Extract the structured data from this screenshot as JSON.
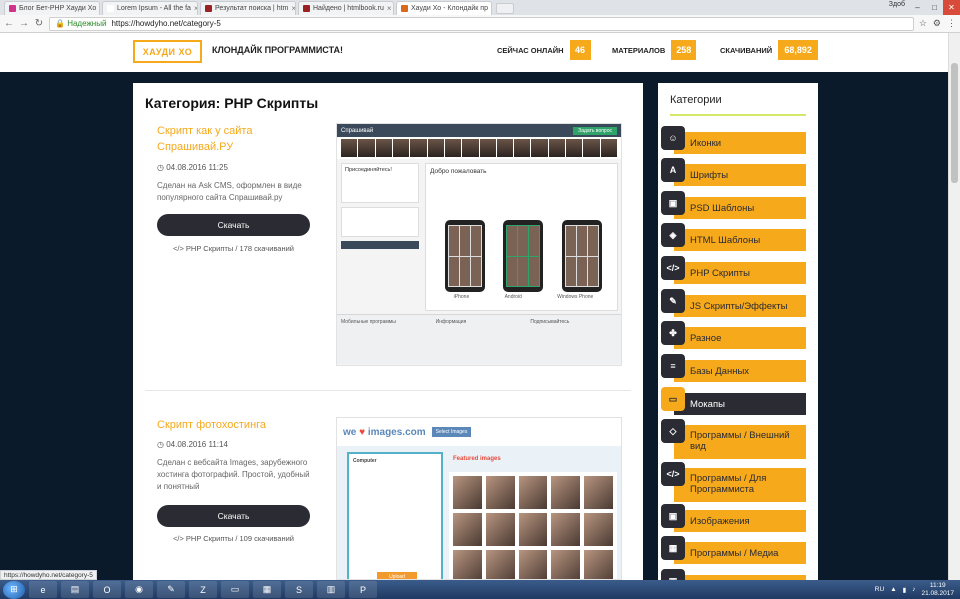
{
  "browser": {
    "tabs": [
      {
        "label": "Блог Бет-PHP Хауди Хо",
        "color": "#d0338a",
        "active": false
      },
      {
        "label": "Lorem Ipsum - All the fa",
        "color": "#ffffff",
        "active": false
      },
      {
        "label": "Результат поиска | htm",
        "color": "#9a2222",
        "active": false
      },
      {
        "label": "Найдено | htmlbook.ru",
        "color": "#9a2222",
        "active": false
      },
      {
        "label": "Хауди Хо - Клондайк пр",
        "color": "#d96a1b",
        "active": true
      }
    ],
    "user_label": "Здоб",
    "security_label": "Надежный",
    "url": "https://howdyho.net/category-5",
    "window_controls": [
      "–",
      "□",
      "✕"
    ],
    "tool_icons": [
      "☆",
      "⚙",
      "⋮"
    ]
  },
  "header": {
    "logo": "ХАУДИ ХО",
    "tagline": "КЛОНДАЙК ПРОГРАММИСТА!",
    "stats": [
      {
        "label": "СЕЙЧАС ОНЛАЙН",
        "value": "46"
      },
      {
        "label": "МАТЕРИАЛОВ",
        "value": "258"
      },
      {
        "label": "СКАЧИВАНИЙ",
        "value": "68,892"
      }
    ]
  },
  "content": {
    "category_title": "Категория: PHP Скрипты",
    "posts": [
      {
        "title": "Скрипт как у сайта Спрашивай.РУ",
        "date": "◷ 04.08.2016 11:25",
        "desc": "Сделан на Ask CMS, оформлен в виде популярного сайта Спрашивай.ру",
        "button": "Скачать",
        "meta": "</> PHP Скрипты / 178 скачиваний",
        "mock": {
          "brand": "Спрашивай",
          "pill": "Задать вопрос",
          "left_title": "Присоединяйтесь!",
          "welcome": "Добро пожаловать",
          "platforms": [
            "iPhone",
            "Android",
            "Windows Phone"
          ],
          "footer": [
            "Мобильные программы",
            "Информация",
            "Подписывайтесь"
          ]
        }
      },
      {
        "title": "Скрипт фотохостинга",
        "date": "◷ 04.08.2016 11:14",
        "desc": "Сделан с вебсайта Images, зарубежного хостинга фотографий. Простой, удобный и понятный",
        "button": "Скачать",
        "meta": "</> PHP Скрипты / 109 скачиваний",
        "mock": {
          "logo_a": "we ",
          "logo_heart": "♥",
          "logo_b": " images.com",
          "btn": "Select Images",
          "panel_title": "Computer",
          "upload": "Upload",
          "gallery_title": "Featured images"
        }
      }
    ]
  },
  "sidebar": {
    "title": "Категории",
    "items": [
      {
        "label": "Иконки",
        "icon": "☺",
        "icon_name": "smiley-icon"
      },
      {
        "label": "Шрифты",
        "icon": "A",
        "icon_name": "font-icon"
      },
      {
        "label": "PSD Шаблоны",
        "icon": "▣",
        "icon_name": "image-icon"
      },
      {
        "label": "HTML Шаблоны",
        "icon": "◈",
        "icon_name": "cube-icon"
      },
      {
        "label": "PHP Скрипты",
        "icon": "</>",
        "icon_name": "code-icon"
      },
      {
        "label": "JS Скрипты/Эффекты",
        "icon": "✎",
        "icon_name": "wand-icon"
      },
      {
        "label": "Разное",
        "icon": "✤",
        "icon_name": "cubes-icon"
      },
      {
        "label": "Базы Данных",
        "icon": "≡",
        "icon_name": "database-icon"
      },
      {
        "label": "Мокапы",
        "icon": "▭",
        "icon_name": "monitor-icon",
        "active": true
      },
      {
        "label": "Программы / Внешний вид",
        "icon": "◇",
        "icon_name": "diamond-icon",
        "tall": true
      },
      {
        "label": "Программы / Для Программиста",
        "icon": "</>",
        "icon_name": "code-icon",
        "tall": true
      },
      {
        "label": "Изображения",
        "icon": "▣",
        "icon_name": "image-icon"
      },
      {
        "label": "Программы / Медиа",
        "icon": "▦",
        "icon_name": "film-icon"
      },
      {
        "label": "",
        "icon": "▣",
        "icon_name": "image-icon"
      }
    ]
  },
  "status_link": "https://howdyho.net/category-5",
  "taskbar": {
    "lang": "RU",
    "time": "11:19",
    "date": "21.08.2017"
  }
}
